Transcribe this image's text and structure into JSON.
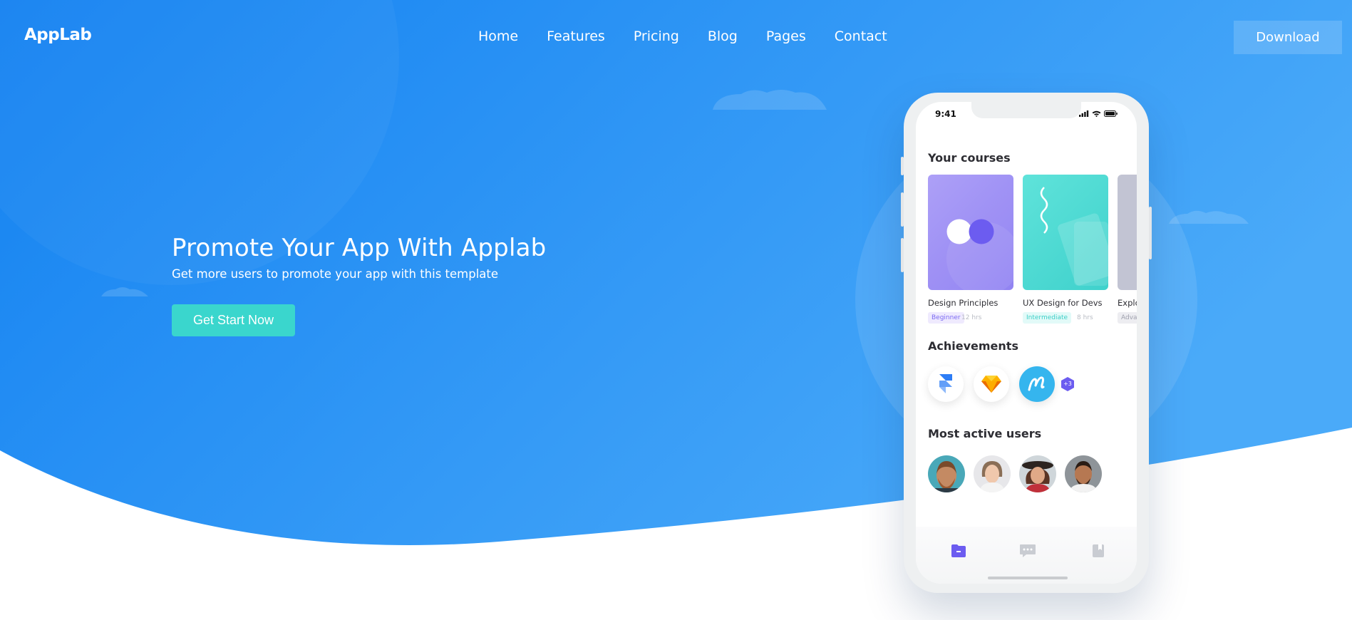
{
  "header": {
    "logo": "AppLab",
    "nav": [
      "Home",
      "Features",
      "Pricing",
      "Blog",
      "Pages",
      "Contact"
    ],
    "download_label": "Download"
  },
  "hero": {
    "title": "Promote Your App With Applab",
    "subtitle": "Get more users to promote your app with this template",
    "cta_label": "Get Start Now"
  },
  "colors": {
    "hero_gradient_start": "#1a85f2",
    "hero_gradient_end": "#46a8f8",
    "cta": "#3ad6cd",
    "accent_purple": "#6c5cf0",
    "accent_teal": "#3fd8d2"
  },
  "phone": {
    "status_time": "9:41",
    "courses_title": "Your courses",
    "courses": [
      {
        "name": "Design Principles",
        "level": "Beginner",
        "hours": "12 hrs"
      },
      {
        "name": "UX Design for Devs",
        "level": "Intermediate",
        "hours": "8 hrs"
      },
      {
        "name": "Explor",
        "level": "Advan",
        "hours": ""
      }
    ],
    "achievements_title": "Achievements",
    "achievements_more": "+3",
    "achievement_icons": [
      "framer-icon",
      "sketch-icon",
      "marvel-icon"
    ],
    "users_title": "Most active users",
    "tabs": [
      "courses-tab-icon",
      "messages-tab-icon",
      "bookmarks-tab-icon"
    ]
  }
}
